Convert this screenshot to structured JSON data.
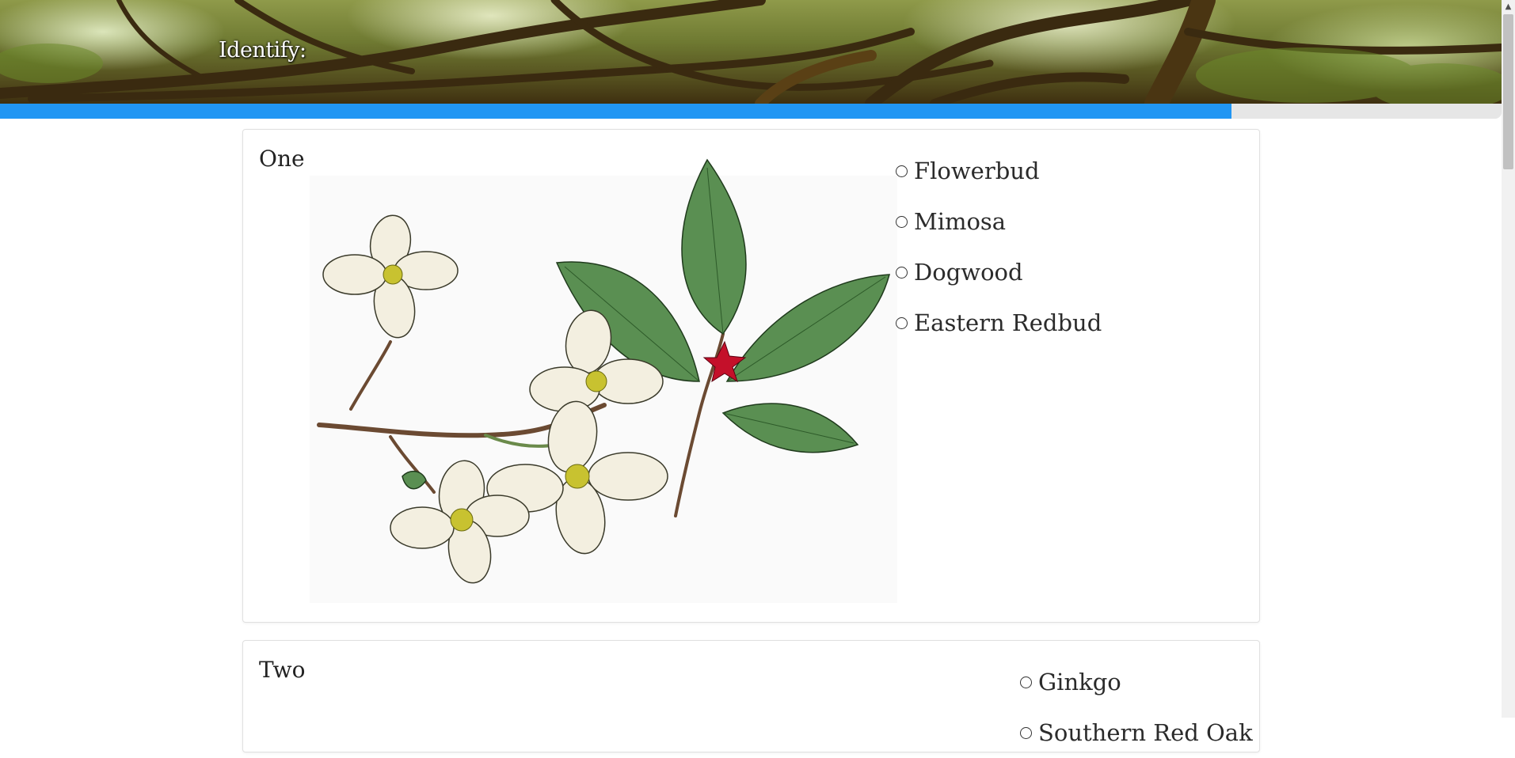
{
  "header": {
    "title": "Identify:",
    "progress_fraction": 0.82
  },
  "questions": [
    {
      "title": "One",
      "options": [
        "Flowerbud",
        "Mimosa",
        "Dogwood",
        "Eastern Redbud"
      ]
    },
    {
      "title": "Two",
      "options": [
        "Ginkgo",
        "Southern Red Oak"
      ]
    }
  ],
  "colors": {
    "progress": "#2196f3",
    "progress_track": "#e6e6e6"
  }
}
